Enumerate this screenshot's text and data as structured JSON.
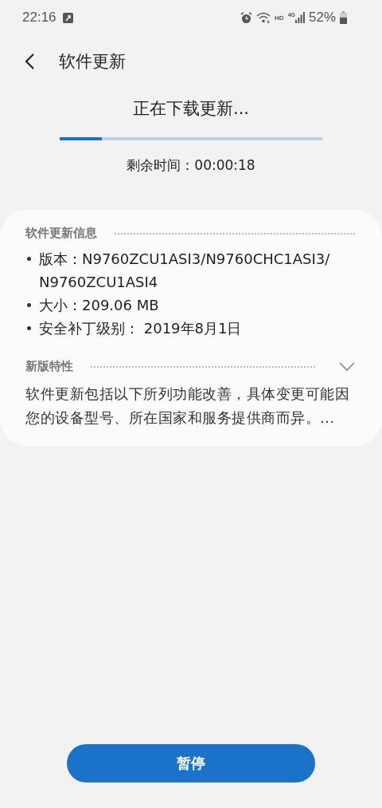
{
  "status_bar": {
    "time": "22:16",
    "hd": "HD",
    "network": "4G",
    "battery_text": "52%"
  },
  "header": {
    "title": "软件更新"
  },
  "download": {
    "title": "正在下载更新...",
    "level": 0.16,
    "remaining": "剩余时间：00:00:18"
  },
  "info": {
    "heading": "软件更新信息",
    "items": [
      "版本：N9760ZCU1ASI3/N9760CHC1ASI3/N9760ZCU1ASI4",
      "大小：209.06 MB",
      "安全补丁级别： 2019年8月1日"
    ]
  },
  "features": {
    "heading": "新版特性",
    "expanded": false,
    "text": "软件更新包括以下所列功能改善，具体变更可能因您的设备型号、所在国家和服务提供商而异。..."
  },
  "button": {
    "label": "暂停"
  }
}
